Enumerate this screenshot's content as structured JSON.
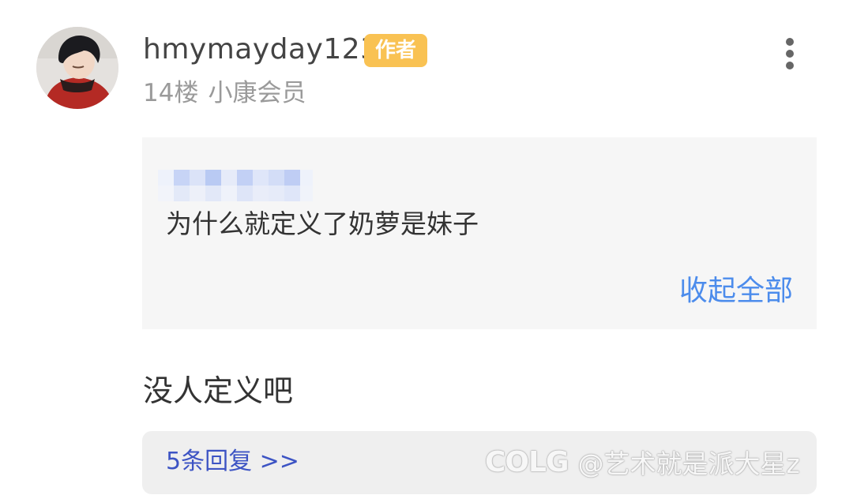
{
  "post": {
    "username": "hmymayday123",
    "author_badge": "作者",
    "floor": "14楼",
    "member_level": "小康会员",
    "avatar_icon": "user-avatar",
    "more_icon": "more-vertical-icon"
  },
  "quote": {
    "text": "为什么就定义了奶萝是妹子",
    "collapse_label": "收起全部"
  },
  "reply": {
    "text": "没人定义吧"
  },
  "replies": {
    "link_label": "5条回复 >>"
  },
  "watermark": {
    "logo": "COLG",
    "handle": "@艺术就是派大星z"
  },
  "colors": {
    "badge": "#f9c253",
    "link_blue": "#4c8cec",
    "replies_blue": "#3d54c4",
    "quote_bg": "#f6f6f6",
    "meta_gray": "#9a9a9a"
  }
}
